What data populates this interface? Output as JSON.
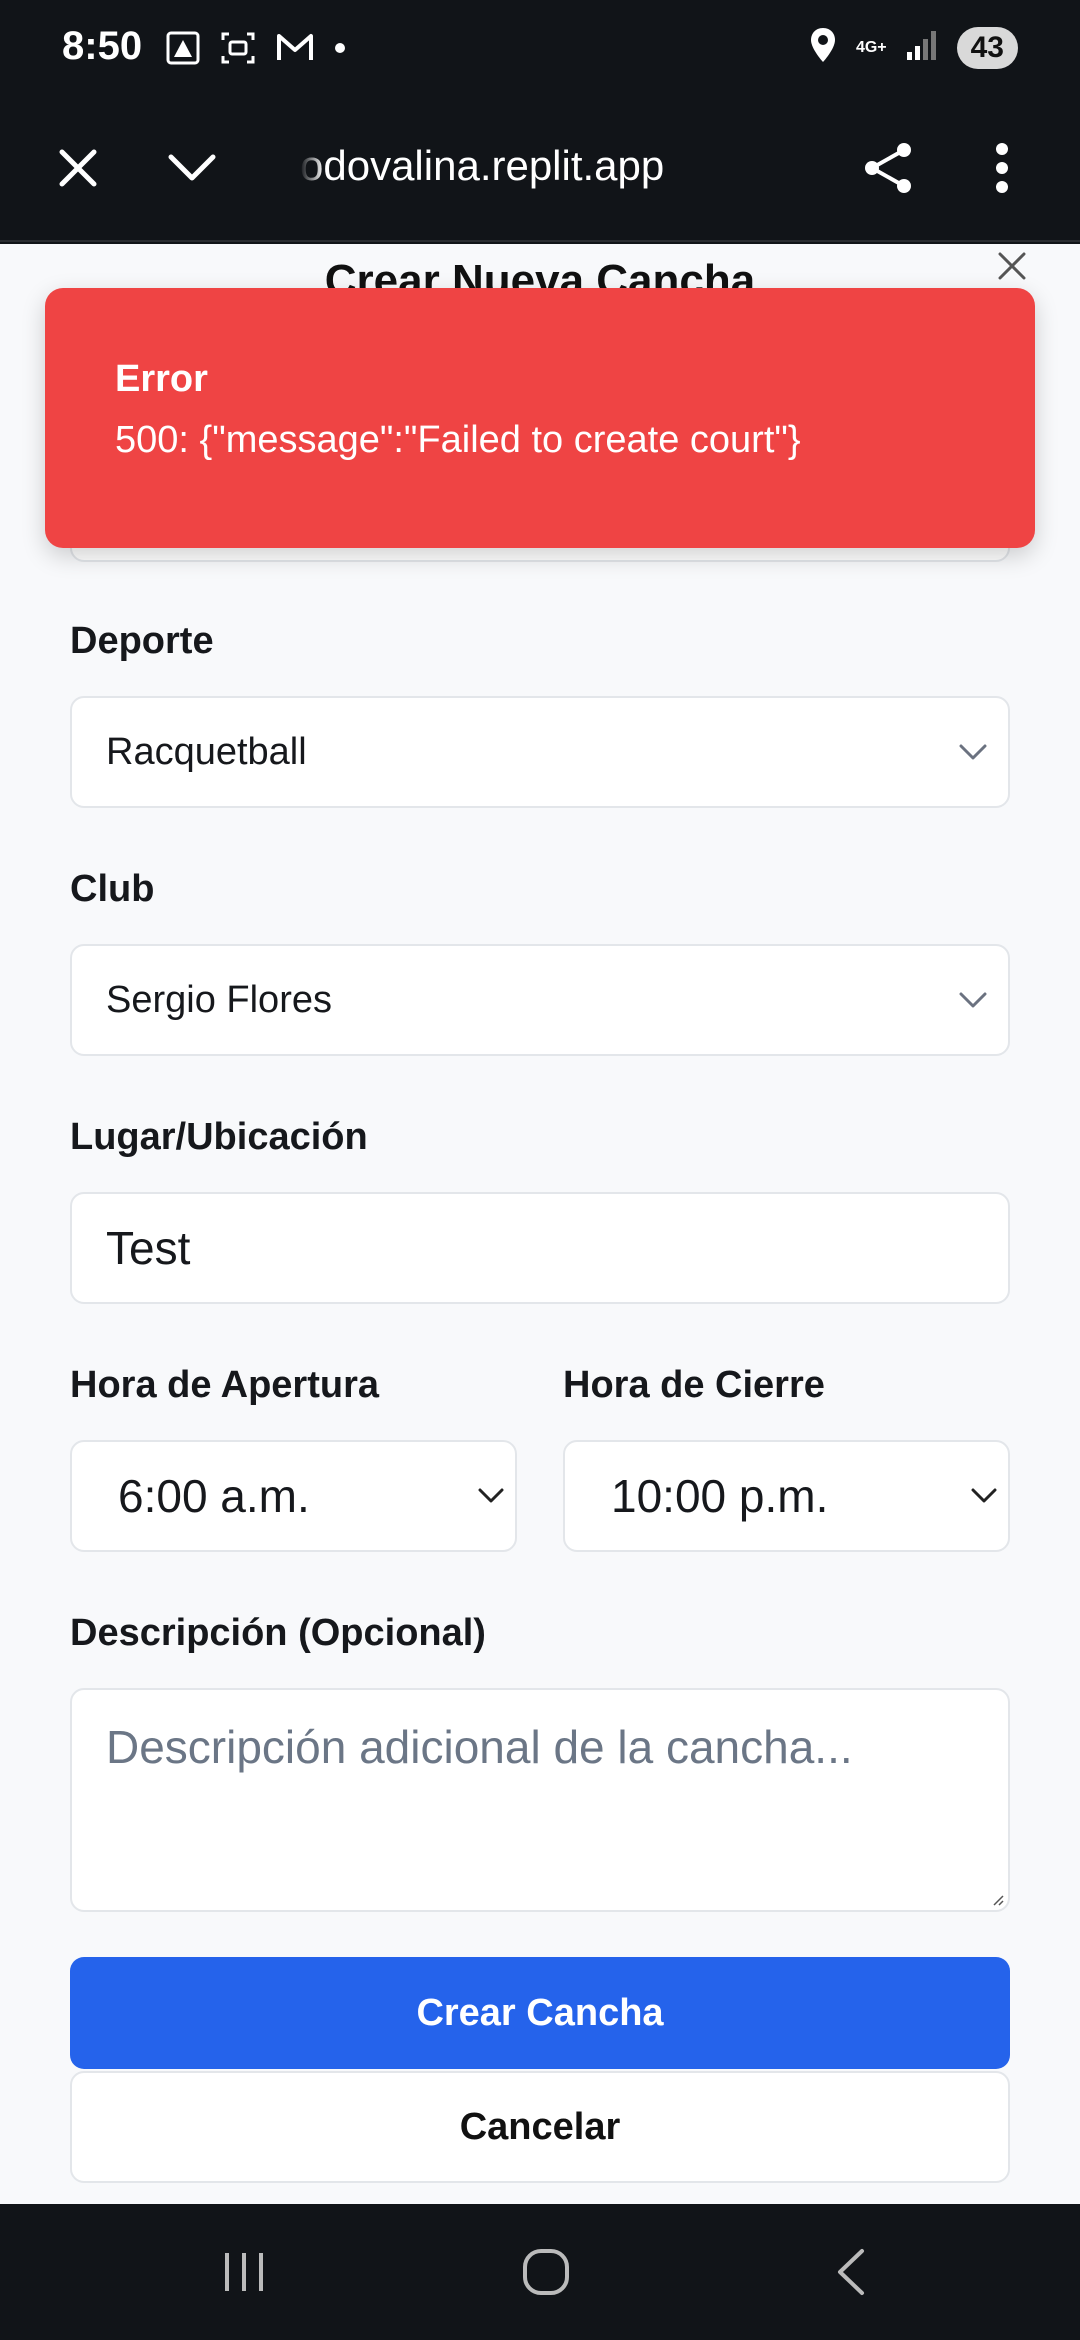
{
  "status_bar": {
    "time": "8:50",
    "network": "4G+",
    "battery": "43",
    "icons": [
      "app-icon",
      "screenshot-icon",
      "gmail-icon",
      "dot-icon",
      "location-icon",
      "signal-icon"
    ]
  },
  "browser": {
    "url": "odovalina.replit.app",
    "icons": [
      "close-icon",
      "chevron-down-icon",
      "share-icon",
      "more-vert-icon"
    ]
  },
  "modal": {
    "title": "Crear Nueva Cancha",
    "fields": {
      "sport": {
        "label": "Deporte",
        "value": "Racquetball"
      },
      "club": {
        "label": "Club",
        "value": "Sergio Flores"
      },
      "location": {
        "label": "Lugar/Ubicación",
        "value": "Test"
      },
      "open_time": {
        "label": "Hora de Apertura",
        "value": "6:00 a.m."
      },
      "close_time": {
        "label": "Hora de Cierre",
        "value": "10:00 p.m."
      },
      "description": {
        "label": "Descripción (Opcional)",
        "placeholder": "Descripción adicional de la cancha..."
      }
    },
    "buttons": {
      "create": "Crear Cancha",
      "cancel": "Cancelar"
    }
  },
  "toast": {
    "title": "Error",
    "description": "500: {\"message\":\"Failed to create court\"}"
  },
  "colors": {
    "error": "#ef4444",
    "primary": "#2563eb",
    "chrome": "#111418"
  }
}
